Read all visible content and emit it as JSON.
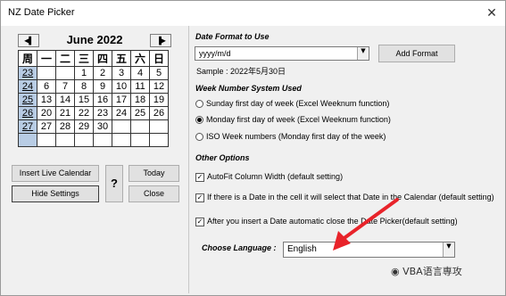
{
  "window": {
    "title": "NZ Date Picker",
    "close_glyph": "✕"
  },
  "calendar": {
    "prev_label": "◀▌",
    "next_label": "▐▶",
    "month_year": "June 2022",
    "weekday_headers": [
      "周",
      "一",
      "二",
      "三",
      "四",
      "五",
      "六",
      "日"
    ],
    "rows": [
      [
        "23",
        "",
        "",
        "1",
        "2",
        "3",
        "4",
        "5"
      ],
      [
        "24",
        "6",
        "7",
        "8",
        "9",
        "10",
        "11",
        "12"
      ],
      [
        "25",
        "13",
        "14",
        "15",
        "16",
        "17",
        "18",
        "19"
      ],
      [
        "26",
        "20",
        "21",
        "22",
        "23",
        "24",
        "25",
        "26"
      ],
      [
        "27",
        "27",
        "28",
        "29",
        "30",
        "",
        "",
        ""
      ],
      [
        "",
        "",
        "",
        "",
        "",
        "",
        "",
        ""
      ]
    ]
  },
  "buttons": {
    "insert_live": "Insert Live Calendar",
    "hide_settings": "Hide Settings",
    "help": "?",
    "today": "Today",
    "close": "Close",
    "add_format": "Add Format"
  },
  "date_format": {
    "header": "Date Format to Use",
    "value": "yyyy/m/d",
    "sample": "Sample : 2022年5月30日"
  },
  "week_system": {
    "header": "Week Number System Used",
    "options": [
      {
        "label": "Sunday first day of week (Excel Weeknum function)",
        "selected": false
      },
      {
        "label": "Monday first day of week (Excel Weeknum function)",
        "selected": true
      },
      {
        "label": "ISO Week numbers (Monday first day of the week)",
        "selected": false
      }
    ]
  },
  "other_options": {
    "header": "Other Options",
    "items": [
      {
        "label": "AutoFit Column Width (default setting)",
        "checked": true
      },
      {
        "label": "If there is a Date in the cell it will select that Date in the Calendar (default setting)",
        "checked": true
      },
      {
        "label": "After you insert a Date automatic close the Date Picker(default setting)",
        "checked": true
      }
    ]
  },
  "language": {
    "label": "Choose Language :",
    "value": "English"
  },
  "watermark": "VBA语言専攻",
  "colors": {
    "week_cell": "#b8cce4",
    "arrow": "#e8232a"
  }
}
